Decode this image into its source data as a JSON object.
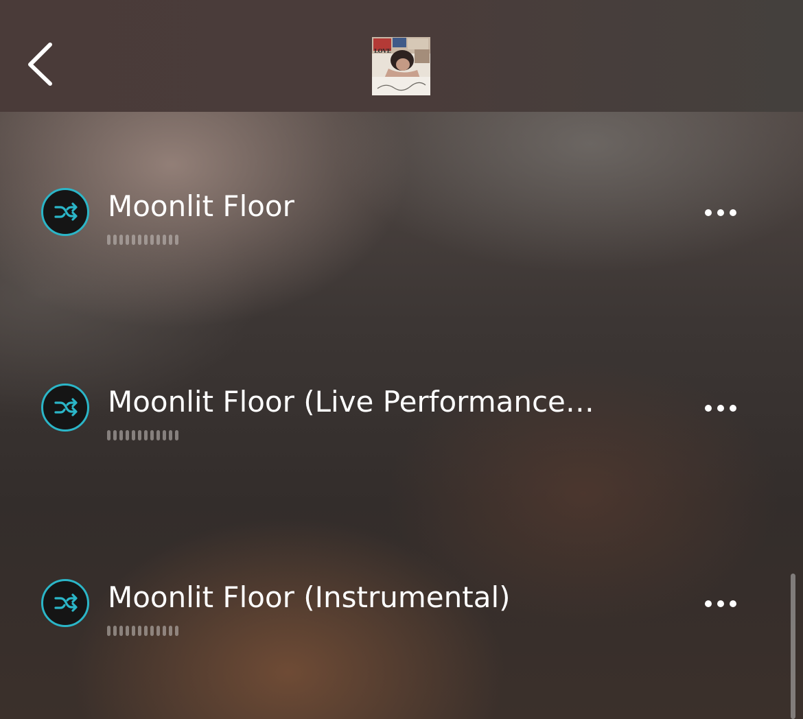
{
  "header": {
    "back_icon": "chevron-left-icon",
    "album_art": {
      "kind": "album-cover-thumbnail",
      "cover_text": "LOVE"
    }
  },
  "tracks": [
    {
      "title": "Moonlit Floor",
      "icon": "shuffle-icon",
      "more_icon": "more-horizontal-icon"
    },
    {
      "title": "Moonlit Floor (Live Performance…",
      "icon": "shuffle-icon",
      "more_icon": "more-horizontal-icon"
    },
    {
      "title": "Moonlit Floor (Instrumental)",
      "icon": "shuffle-icon",
      "more_icon": "more-horizontal-icon"
    }
  ],
  "colors": {
    "accent": "#2bb6c8",
    "text": "#ffffff",
    "header_bg": "#4a3c3a",
    "badge_bg": "#151515"
  }
}
